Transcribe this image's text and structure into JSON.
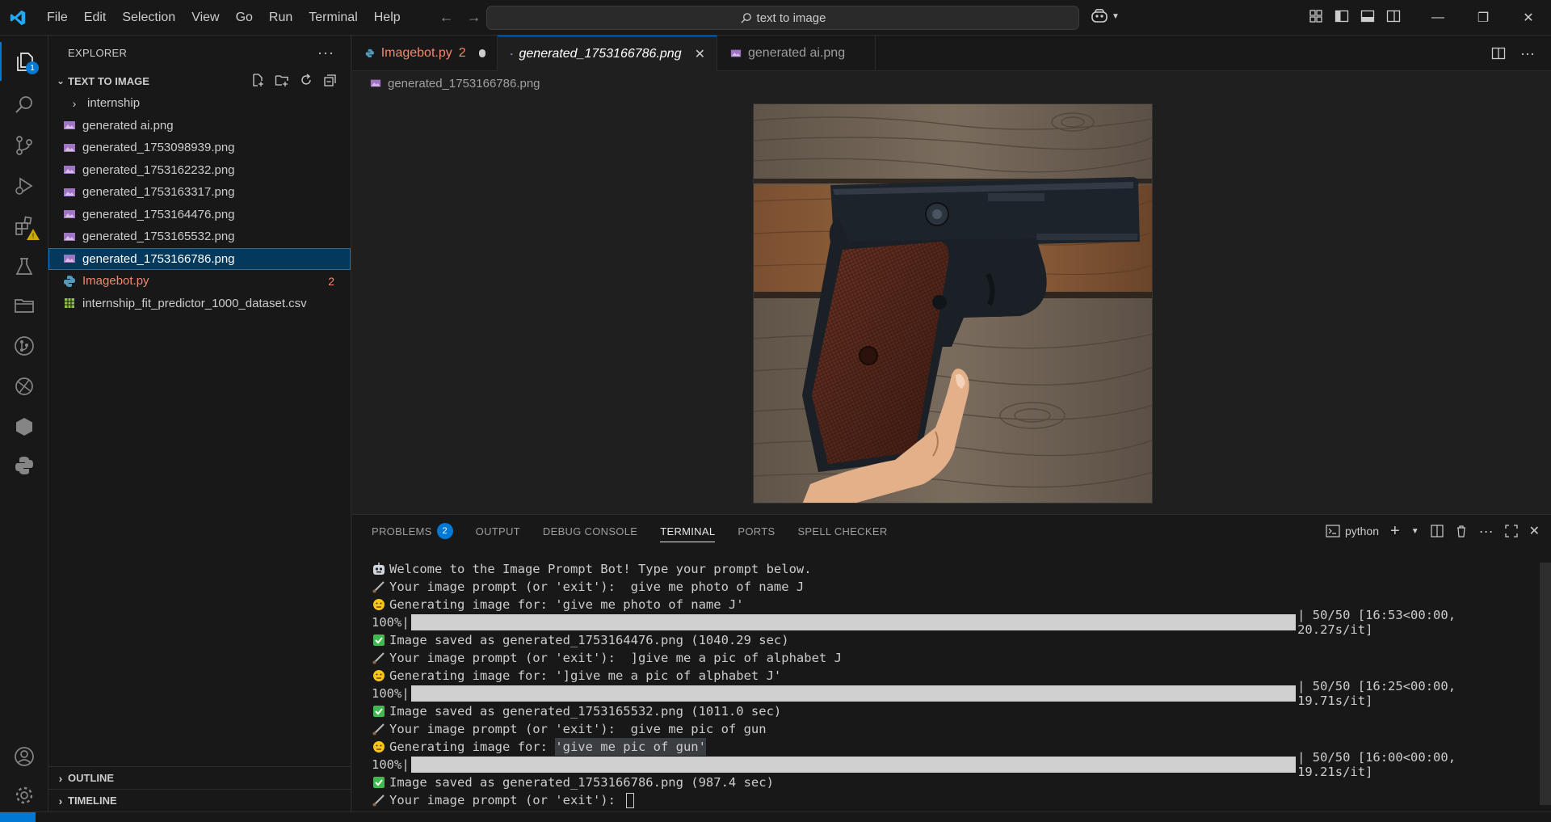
{
  "titlebar": {
    "menu": [
      "File",
      "Edit",
      "Selection",
      "View",
      "Go",
      "Run",
      "Terminal",
      "Help"
    ],
    "search": "text to image"
  },
  "activity": {
    "explorer_badge": "1"
  },
  "sidebar": {
    "header": "EXPLORER",
    "section": "TEXT TO IMAGE",
    "items": [
      {
        "label": "internship",
        "type": "folder"
      },
      {
        "label": "generated ai.png",
        "type": "image"
      },
      {
        "label": "generated_1753098939.png",
        "type": "image"
      },
      {
        "label": "generated_1753162232.png",
        "type": "image"
      },
      {
        "label": "generated_1753163317.png",
        "type": "image"
      },
      {
        "label": "generated_1753164476.png",
        "type": "image"
      },
      {
        "label": "generated_1753165532.png",
        "type": "image"
      },
      {
        "label": "generated_1753166786.png",
        "type": "image",
        "selected": true
      },
      {
        "label": "Imagebot.py",
        "type": "python",
        "count": "2"
      },
      {
        "label": "internship_fit_predictor_1000_dataset.csv",
        "type": "csv"
      }
    ],
    "outline": "OUTLINE",
    "timeline": "TIMELINE"
  },
  "tabs": [
    {
      "label": "Imagebot.py",
      "count": "2"
    },
    {
      "label": "generated_1753166786.png"
    },
    {
      "label": "generated ai.png"
    }
  ],
  "breadcrumb": "generated_1753166786.png",
  "panel": {
    "tabs": [
      "PROBLEMS",
      "OUTPUT",
      "DEBUG CONSOLE",
      "TERMINAL",
      "PORTS",
      "SPELL CHECKER"
    ],
    "problems_count": "2",
    "shell": "python"
  },
  "terminal": {
    "l1": "Welcome to the Image Prompt Bot! Type your prompt below.",
    "l2": "Your image prompt (or 'exit'):  give me photo of name J",
    "l3": "Generating image for: 'give me photo of name J'",
    "p1_pct": "100%|",
    "p1_stat": "| 50/50 [16:53<00:00, 20.27s/it]",
    "l5": "Image saved as generated_1753164476.png (1040.29 sec)",
    "l6": "Your image prompt (or 'exit'):  ]give me a pic of alphabet J",
    "l7": "Generating image for: ']give me a pic of alphabet J'",
    "p2_pct": "100%|",
    "p2_stat": "| 50/50 [16:25<00:00, 19.71s/it]",
    "l9": "Image saved as generated_1753165532.png (1011.0 sec)",
    "l10": "Your image prompt (or 'exit'):  give me pic of gun",
    "l11a": "Generating image for: ",
    "l11b": "'give me pic of gun'",
    "p3_pct": "100%|",
    "p3_stat": "| 50/50 [16:00<00:00, 19.21s/it]",
    "l13": "Image saved as generated_1753166786.png (987.4 sec)",
    "l14": "Your image prompt (or 'exit'): ",
    "progress": 1.0
  }
}
